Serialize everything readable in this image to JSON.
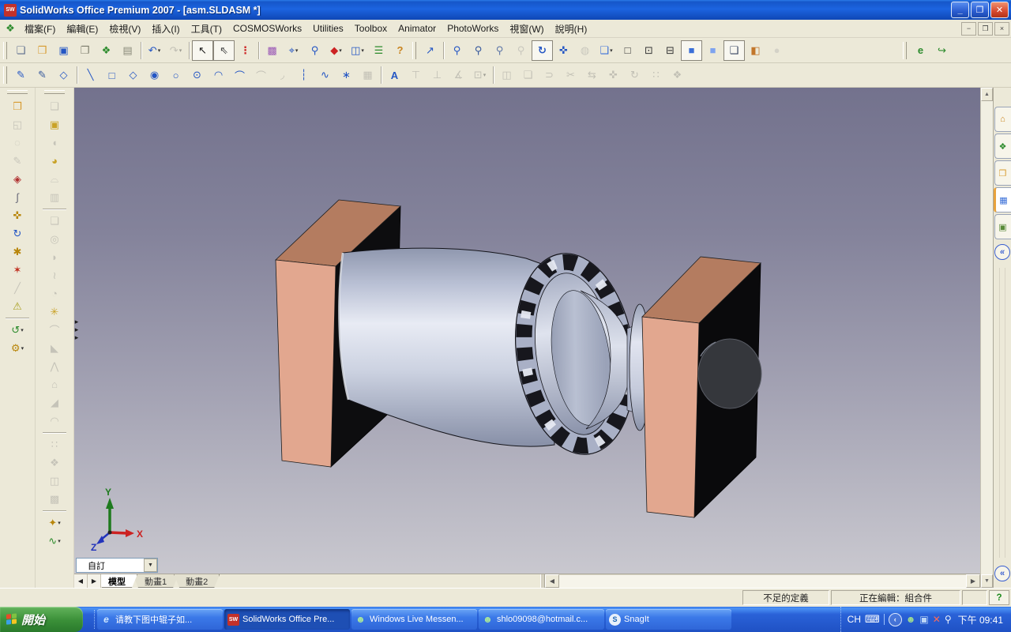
{
  "title": {
    "icon_text": "SW",
    "text": "SolidWorks Office Premium 2007 - [asm.SLDASM *]",
    "controls": {
      "min": "_",
      "restore": "❐",
      "close": "✕"
    }
  },
  "menu": {
    "icon": "❖",
    "items": [
      {
        "name": "menu-file",
        "label": "檔案(F)"
      },
      {
        "name": "menu-edit",
        "label": "編輯(E)"
      },
      {
        "name": "menu-view",
        "label": "檢視(V)"
      },
      {
        "name": "menu-insert",
        "label": "插入(I)"
      },
      {
        "name": "menu-tools",
        "label": "工具(T)"
      },
      {
        "name": "menu-cosmosworks",
        "label": "COSMOSWorks"
      },
      {
        "name": "menu-utilities",
        "label": "Utilities"
      },
      {
        "name": "menu-toolbox",
        "label": "Toolbox"
      },
      {
        "name": "menu-animator",
        "label": "Animator"
      },
      {
        "name": "menu-photoworks",
        "label": "PhotoWorks"
      },
      {
        "name": "menu-window",
        "label": "視窗(W)"
      },
      {
        "name": "menu-help",
        "label": "說明(H)"
      }
    ],
    "controls": {
      "min": "−",
      "restore": "❐",
      "close": "×"
    }
  },
  "toolbar_row1": [
    {
      "name": "toolbar-handle",
      "c": "thandle",
      "ia": "false"
    },
    {
      "name": "new-document-button",
      "g": "❏",
      "s": "color:#5a6b8c"
    },
    {
      "name": "open-button",
      "g": "❒",
      "s": "color:#d79b2f"
    },
    {
      "name": "save-button",
      "g": "▣",
      "s": "color:#2456c4"
    },
    {
      "name": "make-drawing-button",
      "g": "❐",
      "s": "color:#7a7a6a"
    },
    {
      "name": "solidworks-office-button",
      "g": "❖",
      "s": "color:#2c8b2c"
    },
    {
      "name": "print-button",
      "g": "▤",
      "s": "color:#8a8a7a"
    },
    {
      "name": "separator",
      "c": "tsep",
      "ia": "false"
    },
    {
      "name": "undo-button",
      "g": "↶",
      "s": "color:#2456c4",
      "dd": "▾"
    },
    {
      "name": "redo-button",
      "g": "↷",
      "c": "tbtn dis",
      "s": "color:#8a8a7a",
      "dd": "▾"
    },
    {
      "name": "separator",
      "c": "tsep",
      "ia": "false"
    },
    {
      "name": "select-button",
      "g": "↖",
      "c": "tbtn pressed",
      "s": "color:#1a1a1a"
    },
    {
      "name": "selection-filter-button",
      "g": "⇖",
      "c": "tbtn pressed",
      "s": "color:#444"
    },
    {
      "name": "rebuild-button",
      "g": "⋮",
      "s": "color:#cc2222;font-weight:700"
    },
    {
      "name": "separator",
      "c": "tsep",
      "ia": "false"
    },
    {
      "name": "edit-color-button",
      "g": "▩",
      "s": "color:#9b59b6"
    },
    {
      "name": "measure-button",
      "g": "⌖",
      "s": "color:#2456c4",
      "dd": "▾"
    },
    {
      "name": "magnified-selection-button",
      "g": "⚲",
      "s": "color:#2456c4"
    },
    {
      "name": "solidworks-model-button",
      "g": "◆",
      "s": "color:#cc2222",
      "dd": "▾"
    },
    {
      "name": "split-window-button",
      "g": "◫",
      "s": "color:#2456c4",
      "dd": "▾"
    },
    {
      "name": "options-list-button",
      "g": "☰",
      "s": "color:#2c8b2c"
    },
    {
      "name": "help-button",
      "g": "?",
      "s": "color:#c9841f;font-weight:700"
    },
    {
      "name": "toolbar-handle",
      "c": "thandle",
      "ia": "false"
    },
    {
      "name": "view-orientation-button",
      "g": "↗",
      "s": "color:#2456c4"
    },
    {
      "name": "separator",
      "c": "tsep",
      "ia": "false"
    },
    {
      "name": "zoom-fit-button",
      "g": "⚲",
      "s": "color:#2456c4"
    },
    {
      "name": "zoom-area-button",
      "g": "⚲",
      "s": "color:#35589c"
    },
    {
      "name": "zoom-in-out-button",
      "g": "⚲",
      "s": "color:#6078a8"
    },
    {
      "name": "zoom-selection-button",
      "g": "⚲",
      "c": "tbtn dis",
      "s": "color:#999"
    },
    {
      "name": "rotate-view-button",
      "g": "↻",
      "c": "tbtn pressed",
      "s": "color:#2456c4;font-weight:700"
    },
    {
      "name": "pan-button",
      "g": "✜",
      "s": "color:#2456c4"
    },
    {
      "name": "3d-drawing-view-button",
      "g": "◍",
      "c": "tbtn dis",
      "s": "color:#999"
    },
    {
      "name": "standard-views-button",
      "g": "❑",
      "s": "color:#3a6fd8",
      "dd": "▾"
    },
    {
      "name": "wireframe-button",
      "g": "□",
      "s": "color:#333"
    },
    {
      "name": "hidden-lines-visible-button",
      "g": "⊡",
      "s": "color:#333"
    },
    {
      "name": "hidden-lines-removed-button",
      "g": "⊟",
      "s": "color:#333"
    },
    {
      "name": "shaded-with-edges-button",
      "g": "■",
      "c": "tbtn pressed",
      "s": "color:#3a6fd8"
    },
    {
      "name": "shaded-button",
      "g": "■",
      "s": "color:#7ea3ef"
    },
    {
      "name": "shadows-button",
      "g": "❑",
      "c": "tbtn pressed",
      "s": "color:#33415e"
    },
    {
      "name": "section-view-button",
      "g": "◧",
      "s": "color:#c2762a"
    },
    {
      "name": "realview-button",
      "g": "●",
      "c": "tbtn dis",
      "s": "color:#b5b5a5"
    },
    {
      "name": "spacer",
      "c": "tflex",
      "ia": "false"
    },
    {
      "name": "toolbar-handle",
      "c": "thandle",
      "ia": "false"
    },
    {
      "name": "internet-explorer-button",
      "g": "e",
      "s": "color:#2c8b2c;font-weight:700;font-style:italic"
    },
    {
      "name": "hyperlink-button",
      "g": "↪",
      "s": "color:#2c8b2c"
    },
    {
      "name": "end-gap",
      "c": "tend",
      "ia": "false"
    }
  ],
  "toolbar_row2": [
    {
      "name": "toolbar-handle",
      "c": "thandle",
      "ia": "false"
    },
    {
      "name": "sketch-button",
      "g": "✎",
      "s": "color:#2456c4"
    },
    {
      "name": "3d-sketch-button",
      "g": "✎",
      "s": "color:#35589c"
    },
    {
      "name": "modify-sketch-button",
      "g": "◇",
      "s": "color:#2456c4"
    },
    {
      "name": "separator",
      "c": "tsep",
      "ia": "false"
    },
    {
      "name": "line-button",
      "g": "╲",
      "s": "color:#2456c4"
    },
    {
      "name": "rectangle-button",
      "g": "□",
      "s": "color:#2456c4"
    },
    {
      "name": "polygon-button",
      "g": "◇",
      "s": "color:#2456c4"
    },
    {
      "name": "circle-button",
      "g": "◉",
      "s": "color:#2456c4"
    },
    {
      "name": "perimeter-circle-button",
      "g": "○",
      "s": "color:#2456c4"
    },
    {
      "name": "ellipse-button",
      "g": "⊙",
      "s": "color:#2456c4"
    },
    {
      "name": "centerpoint-arc-button",
      "g": "◠",
      "s": "color:#2456c4"
    },
    {
      "name": "tangent-arc-button",
      "g": "⌒",
      "s": "color:#2456c4"
    },
    {
      "name": "three-point-arc-button",
      "g": "⌒",
      "c": "tbtn dis",
      "s": "color:#8a8a7a"
    },
    {
      "name": "sketch-fillet-button",
      "g": "◞",
      "c": "tbtn dis",
      "s": "color:#8a8a7a"
    },
    {
      "name": "centerline-button",
      "g": "┆",
      "s": "color:#2456c4"
    },
    {
      "name": "spline-button",
      "g": "∿",
      "s": "color:#2456c4"
    },
    {
      "name": "point-button",
      "g": "∗",
      "s": "color:#2456c4"
    },
    {
      "name": "construction-geometry-button",
      "g": "▦",
      "c": "tbtn dis",
      "s": "color:#8a8a7a"
    },
    {
      "name": "separator",
      "c": "tsep",
      "ia": "false"
    },
    {
      "name": "sketch-text-button",
      "g": "A",
      "s": "color:#2456c4;font-weight:700"
    },
    {
      "name": "plane-button",
      "g": "⊤",
      "c": "tbtn dis",
      "s": "color:#8a8a7a"
    },
    {
      "name": "add-relation-button",
      "g": "⊥",
      "c": "tbtn dis",
      "s": "color:#8a8a7a"
    },
    {
      "name": "smart-dimension-button",
      "g": "∡",
      "c": "tbtn dis",
      "s": "color:#8a8a7a"
    },
    {
      "name": "dimension-button",
      "g": "⊡",
      "c": "tbtn dis",
      "s": "color:#8a8a7a",
      "dd": "▾"
    },
    {
      "name": "separator",
      "c": "tsep",
      "ia": "false"
    },
    {
      "name": "mirror-entities-button",
      "g": "◫",
      "c": "tbtn dis",
      "s": "color:#8a8a7a"
    },
    {
      "name": "convert-entities-button",
      "g": "❏",
      "c": "tbtn dis",
      "s": "color:#8a8a7a"
    },
    {
      "name": "offset-entities-button",
      "g": "⊃",
      "c": "tbtn dis",
      "s": "color:#8a8a7a"
    },
    {
      "name": "trim-entities-button",
      "g": "✂",
      "c": "tbtn dis",
      "s": "color:#8a8a7a"
    },
    {
      "name": "extend-entities-button",
      "g": "⇆",
      "c": "tbtn dis",
      "s": "color:#8a8a7a"
    },
    {
      "name": "move-entities-button",
      "g": "✜",
      "c": "tbtn dis",
      "s": "color:#8a8a7a"
    },
    {
      "name": "rotate-entities-button",
      "g": "↻",
      "c": "tbtn dis",
      "s": "color:#8a8a7a"
    },
    {
      "name": "linear-sketch-pattern-button",
      "g": "∷",
      "c": "tbtn dis",
      "s": "color:#8a8a7a"
    },
    {
      "name": "circular-sketch-pattern-button",
      "g": "❖",
      "c": "tbtn dis",
      "s": "color:#8a8a7a"
    }
  ],
  "assembly_toolbar": [
    {
      "name": "toolbar-handle",
      "c": "vhandle",
      "ia": "false"
    },
    {
      "name": "insert-components-button",
      "g": "❒",
      "s": "color:#d79b2f"
    },
    {
      "name": "hide-show-components-button",
      "g": "◱",
      "c": "vtbtn dis"
    },
    {
      "name": "change-suppression-button",
      "g": "◌",
      "c": "vtbtn dis"
    },
    {
      "name": "edit-component-button",
      "g": "✎",
      "c": "vtbtn dis"
    },
    {
      "name": "smart-mates-button",
      "g": "◈",
      "s": "color:#b03030"
    },
    {
      "name": "mate-button",
      "g": "∫",
      "s": "color:#667"
    },
    {
      "name": "move-component-button",
      "g": "✜",
      "s": "color:#b8860b"
    },
    {
      "name": "rotate-component-button",
      "g": "↻",
      "s": "color:#2456c4"
    },
    {
      "name": "smart-fasteners-button",
      "g": "✱",
      "s": "color:#b8860b"
    },
    {
      "name": "exploded-view-button",
      "g": "✶",
      "s": "color:#c03020"
    },
    {
      "name": "explode-line-sketch-button",
      "g": "╱",
      "c": "vtbtn dis"
    },
    {
      "name": "interference-detection-button",
      "g": "⚠",
      "s": "color:#a8a020"
    },
    {
      "name": "separator",
      "c": "vsep",
      "ia": "false"
    },
    {
      "name": "simulation-button",
      "g": "↺",
      "s": "color:#2c8b2c",
      "dd": "▾"
    },
    {
      "name": "physical-simulation-button",
      "g": "⚙",
      "s": "color:#b8860b",
      "dd": "▾"
    }
  ],
  "features_toolbar": [
    {
      "name": "toolbar-handle",
      "c": "vhandle",
      "ia": "false"
    },
    {
      "name": "extruded-boss-button",
      "g": "❑",
      "c": "vtbtn dis"
    },
    {
      "name": "edit-part-button",
      "g": "▣",
      "s": "color:#c9a227"
    },
    {
      "name": "revolved-boss-button",
      "g": "◖",
      "c": "vtbtn dis"
    },
    {
      "name": "swept-boss-button",
      "g": "◕",
      "s": "color:#c9a227"
    },
    {
      "name": "lofted-boss-button",
      "g": "⌓",
      "c": "vtbtn dis"
    },
    {
      "name": "thicken-button",
      "g": "▥",
      "c": "vtbtn dis"
    },
    {
      "name": "separator",
      "c": "vsep",
      "ia": "false"
    },
    {
      "name": "extruded-cut-button",
      "g": "❏",
      "c": "vtbtn dis"
    },
    {
      "name": "hole-button",
      "g": "◎",
      "c": "vtbtn dis"
    },
    {
      "name": "revolved-cut-button",
      "g": "◗",
      "c": "vtbtn dis"
    },
    {
      "name": "swept-cut-button",
      "g": "≀",
      "c": "vtbtn dis"
    },
    {
      "name": "lofted-cut-button",
      "g": "◔",
      "c": "vtbtn dis"
    },
    {
      "name": "hole-wizard-button",
      "g": "✳",
      "s": "color:#c9a227"
    },
    {
      "name": "fillet-button",
      "g": "⌒",
      "c": "vtbtn dis"
    },
    {
      "name": "chamfer-button",
      "g": "◣",
      "c": "vtbtn dis"
    },
    {
      "name": "rib-button",
      "g": "⋀",
      "c": "vtbtn dis"
    },
    {
      "name": "shell-button",
      "g": "⌂",
      "c": "vtbtn dis"
    },
    {
      "name": "draft-button",
      "g": "◢",
      "c": "vtbtn dis"
    },
    {
      "name": "dome-button",
      "g": "◠",
      "c": "vtbtn dis"
    },
    {
      "name": "separator",
      "c": "vsep",
      "ia": "false"
    },
    {
      "name": "linear-pattern-button",
      "g": "∷",
      "c": "vtbtn dis"
    },
    {
      "name": "circular-pattern-button",
      "g": "❖",
      "c": "vtbtn dis"
    },
    {
      "name": "mirror-feature-button",
      "g": "◫",
      "c": "vtbtn dis"
    },
    {
      "name": "pattern-table-button",
      "g": "▩",
      "c": "vtbtn dis"
    },
    {
      "name": "separator",
      "c": "vsep",
      "ia": "false"
    },
    {
      "name": "reference-geometry-button",
      "g": "✦",
      "s": "color:#b8860b",
      "dd": "▾"
    },
    {
      "name": "curves-button",
      "g": "∿",
      "s": "color:#2c8b2c",
      "dd": "▾"
    }
  ],
  "viewport": {
    "orientation_value": "自訂",
    "combo_arrow": "▼",
    "splitter_arrows": "▸▸▸",
    "triad": {
      "x": "X",
      "y": "Y",
      "z": "Z"
    }
  },
  "tabbar": {
    "prev": "◀",
    "next": "▶",
    "tabs": [
      {
        "name": "tab-model",
        "label": "模型",
        "c": "sheettab active"
      },
      {
        "name": "tab-animation1",
        "label": "動畫1"
      },
      {
        "name": "tab-animation2",
        "label": "動畫2"
      }
    ],
    "hscroll_left": "◀",
    "hscroll_right": "▶"
  },
  "vscrollbar": {
    "up": "▲",
    "down": "▼"
  },
  "taskpane": {
    "tabs": [
      {
        "name": "solidworks-resources-tab",
        "g": "⌂",
        "s": "color:#c9841f"
      },
      {
        "name": "design-library-tab",
        "g": "❖",
        "s": "color:#2c8b2c"
      },
      {
        "name": "file-explorer-tab",
        "g": "❒",
        "s": "color:#d79b2f"
      },
      {
        "name": "view-palette-tab",
        "g": "▦",
        "s": "color:#3a6fd8",
        "c": "tptab selected"
      },
      {
        "name": "photoworks-items-tab",
        "g": "▣",
        "s": "color:#5a8c3a"
      },
      {
        "name": "collapse-taskpane-button",
        "g": "«",
        "c": "tpcollapse",
        "s": "color:#3a5fd0"
      }
    ],
    "collapse2": "«"
  },
  "statusbar": {
    "fields": [
      {
        "name": "status-empty-field",
        "text": "",
        "s": "flex:1;border:none"
      },
      {
        "name": "status-definition-state",
        "text": "不足的定義",
        "s": "width:96px"
      },
      {
        "name": "status-editing-mode",
        "text": "正在編輯：組合件",
        "s": "width:150px"
      },
      {
        "name": "status-small-field",
        "text": "",
        "s": "width:18px"
      }
    ],
    "help": "?"
  },
  "taskbar": {
    "start_label": "開始",
    "tasks": [
      {
        "name": "task-ie-thread",
        "g": "e",
        "is": "color:#cfe6ff;font-style:italic;font-weight:700",
        "in": "internet-explorer-icon",
        "label": "请教下图中辊子如..."
      },
      {
        "name": "task-solidworks",
        "g": "SW",
        "is": "background:#c2312a;color:#fff;font-size:7px;font-weight:700;border-radius:2px",
        "in": "solidworks-icon",
        "label": "SolidWorks Office Pre...",
        "c": "task active"
      },
      {
        "name": "task-messenger",
        "g": "☻",
        "is": "color:#a9e79b",
        "in": "messenger-icon",
        "label": "Windows Live Messen..."
      },
      {
        "name": "task-msn-contact",
        "g": "☻",
        "is": "color:#a9e79b",
        "in": "messenger-contact-icon",
        "label": "shlo09098@hotmail.c..."
      },
      {
        "name": "task-snagit",
        "g": "S",
        "is": "background:#e8f0fa;color:#1a64b4;border-radius:50%;font-size:9px;font-weight:700",
        "in": "snagit-icon",
        "label": "SnagIt"
      }
    ],
    "tray": {
      "lang": "CH",
      "keyboard": "⌨",
      "chevron": "‹",
      "icons": [
        {
          "name": "messenger-tray-icon",
          "g": "☻",
          "s": "color:#9fdc8f"
        },
        {
          "name": "network-signal-tray-icon",
          "g": "▣",
          "s": "color:#bcd6f7"
        },
        {
          "name": "network-disconnected-tray-icon",
          "g": "✕",
          "s": "color:#ff6a55;font-weight:700"
        },
        {
          "name": "search-tray-icon",
          "g": "⚲",
          "s": "color:#eef4fd"
        }
      ],
      "time": "下午 09:41"
    }
  },
  "colors": {
    "titlebar_blue": "#1556c9",
    "taskbar_blue": "#2a62d8",
    "start_green": "#3a8f38",
    "active_task_blue": "#1e4fb4",
    "ui_face": "#ece9d8",
    "viewport_top": "#73728d",
    "viewport_bottom": "#c9c8cf",
    "plate_front": "#e2a78f",
    "plate_top": "#b47c60",
    "plate_side": "#0b0b0d",
    "roller_gray": "#c3c9dc",
    "ring_teeth_black": "#17171d",
    "triad_x_red": "#cc2222",
    "triad_y_green": "#1e7a1e",
    "triad_z_blue": "#2233bb"
  }
}
